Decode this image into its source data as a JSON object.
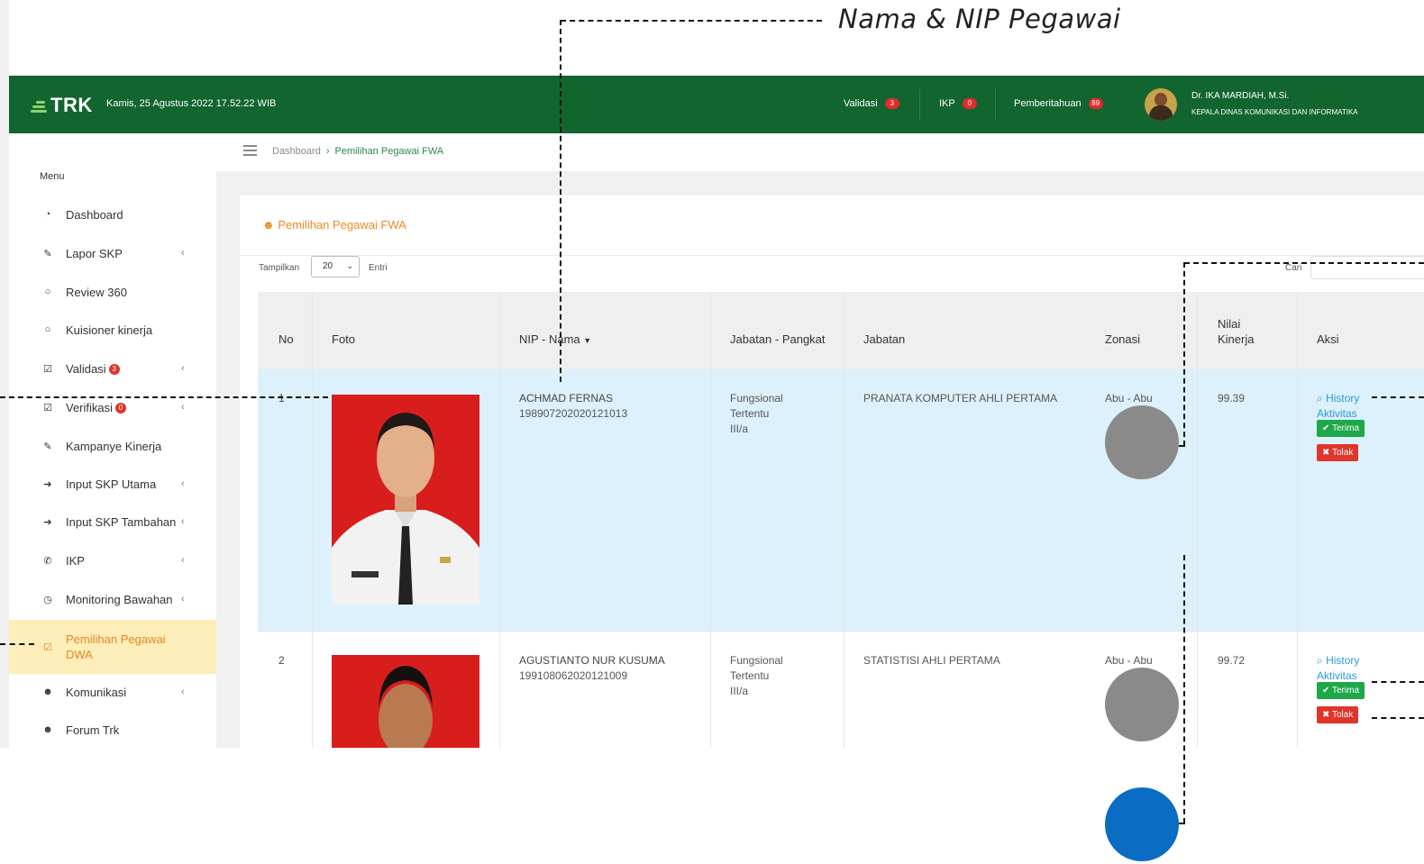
{
  "annotation": {
    "title": "Nama & NIP Pegawai"
  },
  "topbar": {
    "logo_text": "TRK",
    "datetime": "Kamis, 25 Agustus 2022 17.52.22 WIB",
    "nav": [
      {
        "label": "Validasi",
        "badge": "3"
      },
      {
        "label": "IKP",
        "badge": "0"
      },
      {
        "label": "Pemberitahuan",
        "badge": "89"
      }
    ],
    "user": {
      "name": "Dr. IKA MARDIAH, M.Si.",
      "title": "KEPALA DINAS KOMUNIKASI DAN INFORMATIKA"
    },
    "colors": {
      "bar": "#12652e",
      "badge": "#e12a2a"
    }
  },
  "sidebar": {
    "menu_label": "Menu",
    "items": [
      {
        "label": "Dashboard",
        "icon": "dashboard-icon",
        "glyph": "◔",
        "chevron": ""
      },
      {
        "label": "Lapor SKP",
        "icon": "edit-icon",
        "glyph": "✎",
        "chevron": "‹"
      },
      {
        "label": "Review 360",
        "icon": "comment-icon",
        "glyph": "○",
        "chevron": ""
      },
      {
        "label": "Kuisioner kinerja",
        "icon": "comment-icon",
        "glyph": "○",
        "chevron": ""
      },
      {
        "label": "Validasi",
        "icon": "check-square-icon",
        "glyph": "☑",
        "chevron": "‹",
        "badge": "3"
      },
      {
        "label": "Verifikasi",
        "icon": "check-square-outline-icon",
        "glyph": "☑",
        "chevron": "‹",
        "badge": "0"
      },
      {
        "label": "Kampanye Kinerja",
        "icon": "pencil-icon",
        "glyph": "✎",
        "chevron": ""
      },
      {
        "label": "Input SKP Utama",
        "icon": "arrow-right-icon",
        "glyph": "➔",
        "chevron": "‹"
      },
      {
        "label": "Input SKP Tambahan",
        "icon": "arrow-right-icon",
        "glyph": "➔",
        "chevron": "‹"
      },
      {
        "label": "IKP",
        "icon": "bullhorn-icon",
        "glyph": "✆",
        "chevron": "‹"
      },
      {
        "label": "Monitoring Bawahan",
        "icon": "clock-icon",
        "glyph": "◷",
        "chevron": "‹"
      },
      {
        "label": "Pemilihan Pegawai DWA",
        "icon": "check-square-icon",
        "glyph": "☑",
        "chevron": "",
        "active": true
      },
      {
        "label": "Komunikasi",
        "icon": "users-icon",
        "glyph": "☻",
        "chevron": "‹"
      },
      {
        "label": "Forum Trk",
        "icon": "users-icon",
        "glyph": "☻",
        "chevron": ""
      }
    ],
    "active_color": "#e9871d"
  },
  "breadcrumb": {
    "home": "Dashboard",
    "separator": "›",
    "current": "Pemilihan Pegawai FWA"
  },
  "panel": {
    "title": "Pemilihan Pegawai FWA",
    "title_icon": "users-icon",
    "show_label": "Tampilkan",
    "page_size": "20",
    "entries_label": "Entri",
    "search_label": "Cari"
  },
  "table": {
    "headers": {
      "no": "No",
      "foto": "Foto",
      "nip_nama": "NIP - Nama",
      "jabatan_pangkat": "Jabatan - Pangkat",
      "jabatan": "Jabatan",
      "zonasi": "Zonasi",
      "nilai": "Nilai Kinerja",
      "aksi": "Aksi"
    },
    "rows": [
      {
        "no": "1",
        "nama": "ACHMAD FERNAS",
        "nip": "198907202020121013",
        "jab_pangkat": [
          "Fungsional",
          "Tertentu",
          "III/a"
        ],
        "jabatan": "PRANATA KOMPUTER AHLI PERTAMA",
        "zonasi": "Abu - Abu",
        "nilai": "99.39",
        "history": "History",
        "aktivitas": "Aktivitas",
        "terima": "Terima",
        "tolak": "Tolak"
      },
      {
        "no": "2",
        "nama": "AGUSTIANTO NUR KUSUMA",
        "nip": "199108062020121009",
        "jab_pangkat": [
          "Fungsional",
          "Tertentu",
          "III/a"
        ],
        "jabatan": "STATISTISI AHLI PERTAMA",
        "zonasi": "Abu - Abu",
        "nilai": "99.72",
        "history": "History",
        "aktivitas": "Aktivitas",
        "terima": "Terima",
        "tolak": "Tolak"
      }
    ],
    "colors": {
      "highlight_row": "#dcf1fc",
      "zone": "#8a8a8a",
      "accept": "#1ea84a",
      "reject": "#e0352b",
      "link": "#2a9ad6"
    }
  },
  "legend_dot_color": "#0a6cc3"
}
